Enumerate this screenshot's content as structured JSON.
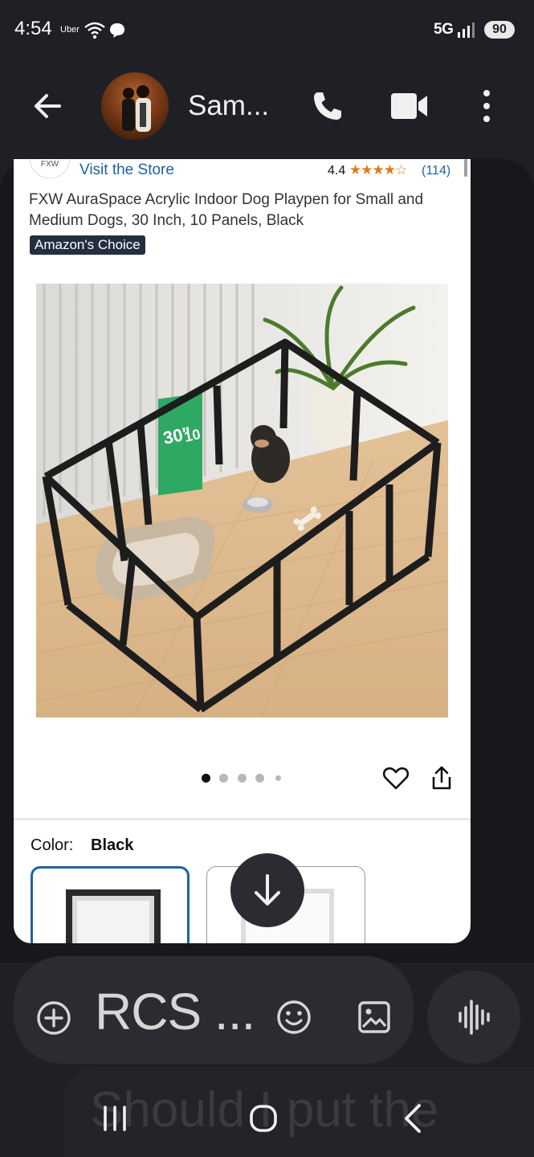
{
  "status_bar": {
    "time": "4:54",
    "carrier_app": "Uber",
    "network": "5G",
    "battery": "90"
  },
  "header": {
    "contact_name": "Sam...",
    "icons": [
      "back-arrow-icon",
      "phone-icon",
      "video-icon",
      "more-vert-icon"
    ]
  },
  "product_card": {
    "store_logo": "FXW",
    "visit_store": "Visit the Store",
    "rating": "4.4",
    "stars": "★★★★☆",
    "review_count": "(114)",
    "title": "FXW AuraSpace Acrylic Indoor Dog Playpen for Small and Medium Dogs, 30 Inch, 10 Panels, Black",
    "badge": "Amazon's Choice",
    "image_sign_size": "30\"",
    "image_sign_panels": "10",
    "carousel_dot_count": 5,
    "active_dot_index": 0,
    "color_label": "Color:",
    "color_value": "Black",
    "swatches": [
      "Black",
      "White"
    ]
  },
  "composer": {
    "placeholder": "RCS ..."
  },
  "background_message": "Should I put the",
  "colors": {
    "background": "#1f2025",
    "amazon_link": "#2162a1",
    "star": "#de7921",
    "badge": "#232f3e"
  }
}
